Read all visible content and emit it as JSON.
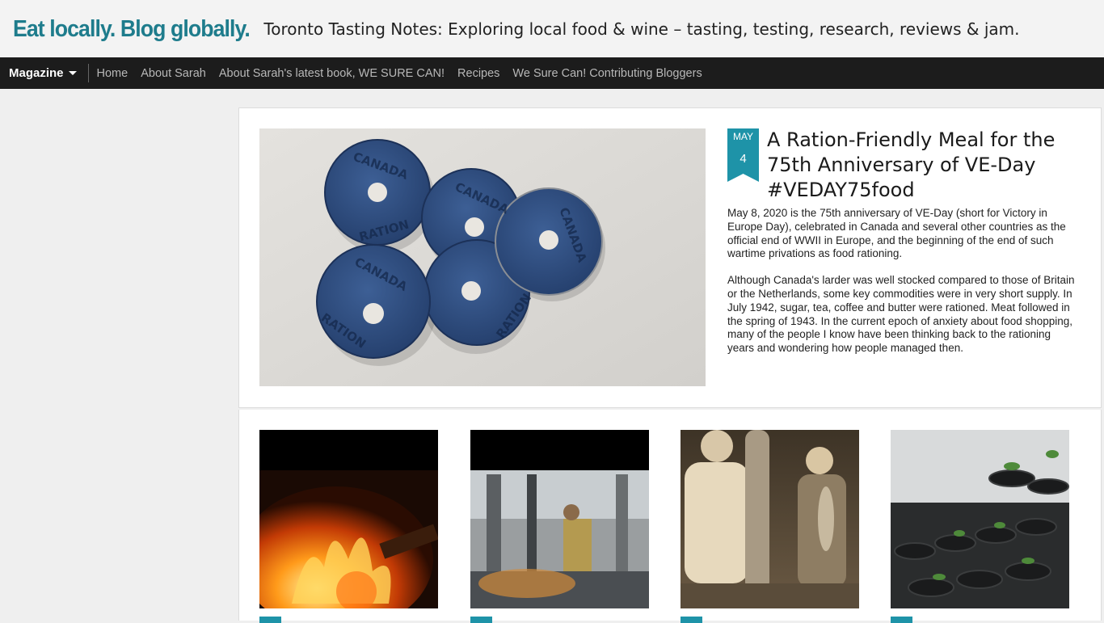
{
  "header": {
    "blog_title": "Eat locally. Blog globally.",
    "blog_description": "Toronto Tasting Notes: Exploring local food & wine – tasting, testing, research, reviews & jam.",
    "title_color": "#1e7c8c"
  },
  "nav": {
    "magazine_label": "Magazine",
    "links": [
      "Home",
      "About Sarah",
      "About Sarah's latest book, WE SURE CAN!",
      "Recipes",
      "We Sure Can! Contributing Bloggers"
    ]
  },
  "featured": {
    "image_icon": "ration-tokens-photo",
    "date": {
      "month": "MAY",
      "day": "4"
    },
    "title": "A Ration-Friendly Meal for the 75th Anniversary of VE-Day #VEDAY75food",
    "paragraphs": [
      "May 8, 2020 is the 75th anniversary of VE-Day (short for Victory in Europe Day), celebrated in Canada and several other countries as the official end of WWII in Europe, and the beginning of the end of such wartime privations as food rationing.",
      "Although Canada's larder was well stocked compared to those of Britain or the Netherlands, some key commodities were in very short supply. In July 1942, sugar, tea, coffee and butter were rationed. Meat followed in the spring of 1943. In the current epoch of anxiety about food shopping, many of the people I know have been thinking back to the rationing years and wondering how people managed then."
    ],
    "badge_color": "#1e93a8"
  },
  "grid": {
    "thumbnails": [
      "wood-fire-photo",
      "kitchen-worker-photo",
      "vintage-fishing-photo",
      "seedlings-pots-photo"
    ]
  }
}
